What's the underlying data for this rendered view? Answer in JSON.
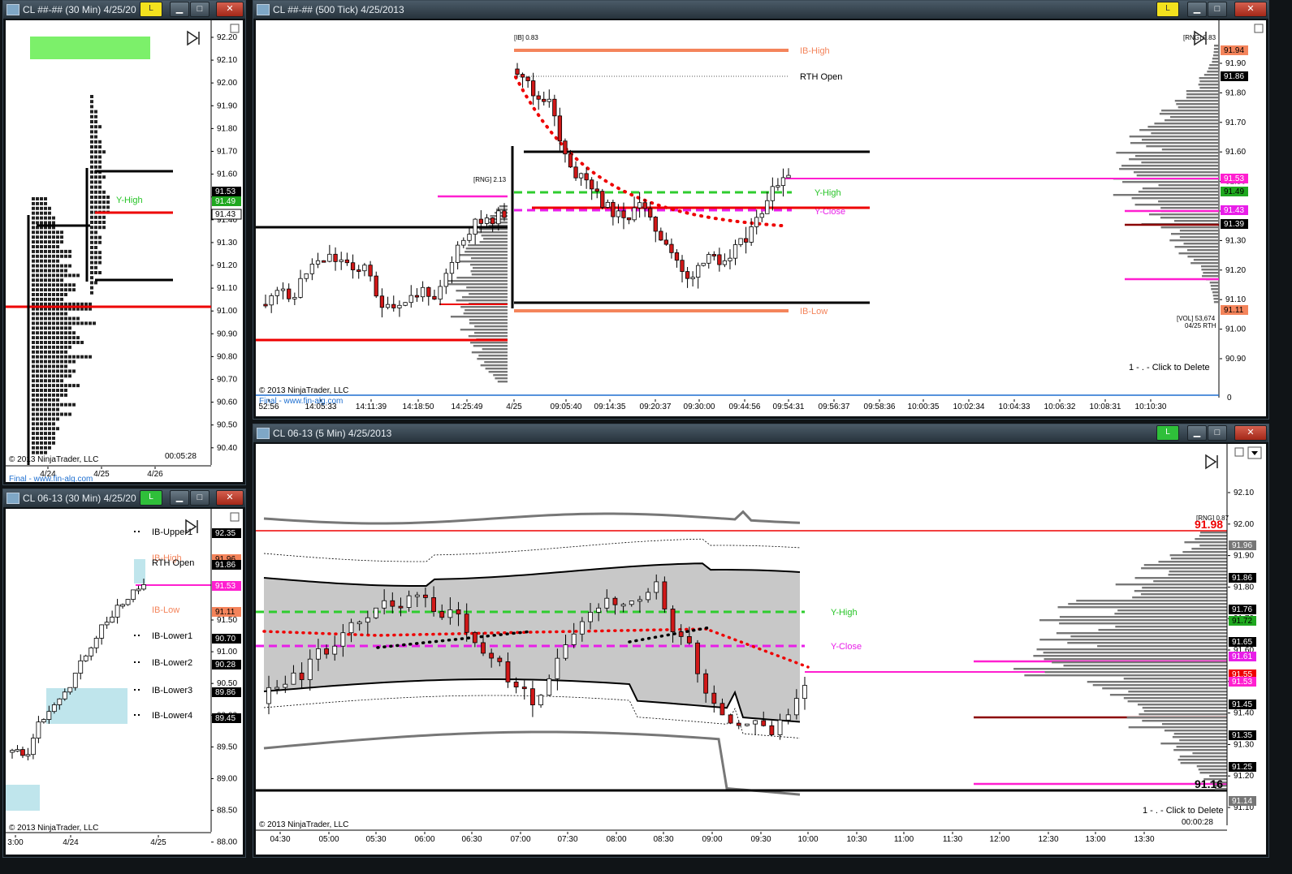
{
  "windows": {
    "w1": {
      "title": "CL ##-## (30 Min)  4/25/20",
      "badge": "L",
      "copyright": "© 2013 NinjaTrader, LLC",
      "link": "Final - www.fin-alg.com",
      "timer": "00:05:28",
      "yhigh": "Y-High",
      "price_labels": [
        "92.20",
        "92.10",
        "92.00",
        "91.90",
        "91.80",
        "91.70",
        "91.60",
        "91.50",
        "91.40",
        "91.30",
        "91.20",
        "91.10",
        "91.00",
        "90.90",
        "90.80",
        "90.70",
        "90.60",
        "90.50",
        "90.40"
      ],
      "markers": {
        "m1": "91.53",
        "m2": "91.49",
        "m3": "91.43"
      },
      "x_labels": [
        "4/24",
        "4/25",
        "4/26"
      ]
    },
    "w2": {
      "title": "CL ##-## (500 Tick)  4/25/2013",
      "badge": "L",
      "copyright": "© 2013 NinjaTrader, LLC",
      "link": "Final - www.fin-alg.com",
      "ib_label": "[IB] 0.83",
      "rng_label": "[RNG] 2.13",
      "rng_label2": "[RNG] 0.83",
      "vol_label": "[VOL] 53,674",
      "vol_sub": "04/25 RTH",
      "ib_high": "IB-High",
      "rth_open": "RTH Open",
      "y_high": "Y-High",
      "y_close": "Y-Close",
      "ib_low": "IB-Low",
      "delete_hint": "1 - . - Click to Delete",
      "price_labels": [
        "91.90",
        "91.80",
        "91.70",
        "91.60",
        "91.50",
        "91.40",
        "91.30",
        "91.20",
        "91.10",
        "91.00",
        "90.90"
      ],
      "markers": {
        "m1": "91.94",
        "m2": "91.86",
        "m3": "91.53",
        "m4": "91.49",
        "m5": "91.43",
        "m6": "91.39",
        "m7": "91.11"
      },
      "zero_label": "0",
      "x_labels": [
        "52:56",
        "14:05:33",
        "14:11:39",
        "14:18:50",
        "14:25:49",
        "4/25",
        "09:05:40",
        "09:14:35",
        "09:20:37",
        "09:30:00",
        "09:44:56",
        "09:54:31",
        "09:56:37",
        "09:58:36",
        "10:00:35",
        "10:02:34",
        "10:04:33",
        "10:06:32",
        "10:08:31",
        "10:10:30"
      ]
    },
    "w3": {
      "title": "CL 06-13 (30 Min)  4/25/20",
      "badge": "L",
      "copyright": "© 2013 NinjaTrader, LLC",
      "levels": {
        "ib_upper1": "IB-Upper1",
        "ib_high": "IB-High",
        "rth_open": "RTH Open",
        "ib_low": "IB-Low",
        "ib_lower1": "IB-Lower1",
        "ib_lower2": "IB-Lower2",
        "ib_lower3": "IB-Lower3",
        "ib_lower4": "IB-Lower4"
      },
      "price_labels": [
        "91.50",
        "91.00",
        "90.50",
        "90.00",
        "89.50",
        "89.00",
        "88.50",
        "88.00"
      ],
      "markers": {
        "m1": "92.35",
        "m2": "91.96",
        "m3": "91.86",
        "m4": "91.53",
        "m5": "91.11",
        "m6": "90.70",
        "m7": "90.28",
        "m8": "89.86",
        "m9": "89.45"
      },
      "x_labels": [
        "3:00",
        "4/24",
        "4/25"
      ]
    },
    "w4": {
      "title": "CL 06-13 (5 Min)  4/25/2013",
      "badge": "L",
      "copyright": "© 2013 NinjaTrader, LLC",
      "y_high": "Y-High",
      "y_close": "Y-Close",
      "delete_hint": "1 - . - Click to Delete",
      "timer": "00:00:28",
      "rng": "[RNG] 0.87",
      "big1": "91.98",
      "big2": "91.16",
      "price_labels": [
        "92.10",
        "92.00",
        "91.90",
        "91.80",
        "91.70",
        "91.60",
        "91.50",
        "91.40",
        "91.30",
        "91.20",
        "91.10"
      ],
      "markers": {
        "m1": "91.96",
        "m2": "91.86",
        "m3": "91.76",
        "m4": "91.72",
        "m5": "91.65",
        "m6": "91.61",
        "m7": "91.55",
        "m8": "91.53",
        "m9": "91.45",
        "m10": "91.35",
        "m11": "91.25",
        "m12": "91.14"
      },
      "x_labels": [
        "04:30",
        "05:00",
        "05:30",
        "06:00",
        "06:30",
        "07:00",
        "07:30",
        "08:00",
        "08:30",
        "09:00",
        "09:30",
        "10:00",
        "10:30",
        "11:00",
        "11:30",
        "12:00",
        "12:30",
        "13:00",
        "13:30"
      ]
    }
  },
  "colors": {
    "up": "#ffffff",
    "down": "#d01818",
    "ib": "#f4845b",
    "yhigh": "#2ecc2e",
    "yclose": "#e81ee8",
    "magenta": "#ff1fd0",
    "red": "#e00000",
    "black": "#000000"
  }
}
